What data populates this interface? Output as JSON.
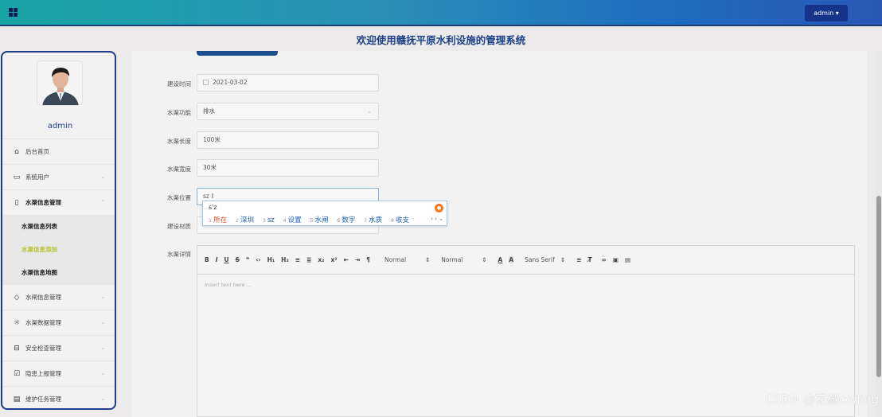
{
  "header": {
    "admin_label": "admin ▾",
    "title": "欢迎使用赣抚平原水利设施的管理系统"
  },
  "sidebar": {
    "user_name": "admin",
    "items": [
      {
        "label": "后台首页",
        "icon": "home-icon"
      },
      {
        "label": "系统用户",
        "icon": "monitor-icon"
      },
      {
        "label": "水渠信息管理",
        "icon": "bookmark-icon"
      },
      {
        "label": "水闸信息管理",
        "icon": "tag-icon"
      },
      {
        "label": "水渠数据管理",
        "icon": "sun-icon"
      },
      {
        "label": "安全检查管理",
        "icon": "inbox-icon"
      },
      {
        "label": "隐患上报管理",
        "icon": "clipboard-icon"
      },
      {
        "label": "维护任务管理",
        "icon": "message-icon"
      }
    ],
    "subitems": [
      {
        "label": "水渠信息列表"
      },
      {
        "label": "水渠信息添加"
      },
      {
        "label": "水渠信息地图"
      }
    ]
  },
  "form": {
    "build_time_label": "建设时间",
    "build_time_value": "2021-03-02",
    "function_label": "水渠功能",
    "function_value": "排水",
    "length_label": "水渠长度",
    "length_value": "100米",
    "width_label": "水渠宽度",
    "width_value": "30米",
    "location_label": "水渠位置",
    "location_value": "sz",
    "material_label": "建设材质",
    "detail_label": "水渠详情"
  },
  "ime": {
    "input": "s'z",
    "candidates": [
      {
        "num": "1",
        "text": "所在"
      },
      {
        "num": "2",
        "text": "深圳"
      },
      {
        "num": "3",
        "text": "sz"
      },
      {
        "num": "4",
        "text": "设置"
      },
      {
        "num": "5",
        "text": "水闸"
      },
      {
        "num": "6",
        "text": "数字"
      },
      {
        "num": "7",
        "text": "水质"
      },
      {
        "num": "8",
        "text": "收支"
      }
    ],
    "nav": "‹ › ⌄"
  },
  "editor": {
    "placeholder": "Insert text here ...",
    "header_select": "Normal",
    "size_select": "Normal",
    "font_select": "Sans Serif",
    "toolbar_buttons": [
      "B",
      "I",
      "U",
      "S",
      "❞",
      "‹›",
      "H₁",
      "H₂",
      "≡",
      "≣",
      "x₂",
      "x²",
      "⇤",
      "⇥",
      "¶"
    ]
  },
  "watermark": "CSDN @花椒coding"
}
